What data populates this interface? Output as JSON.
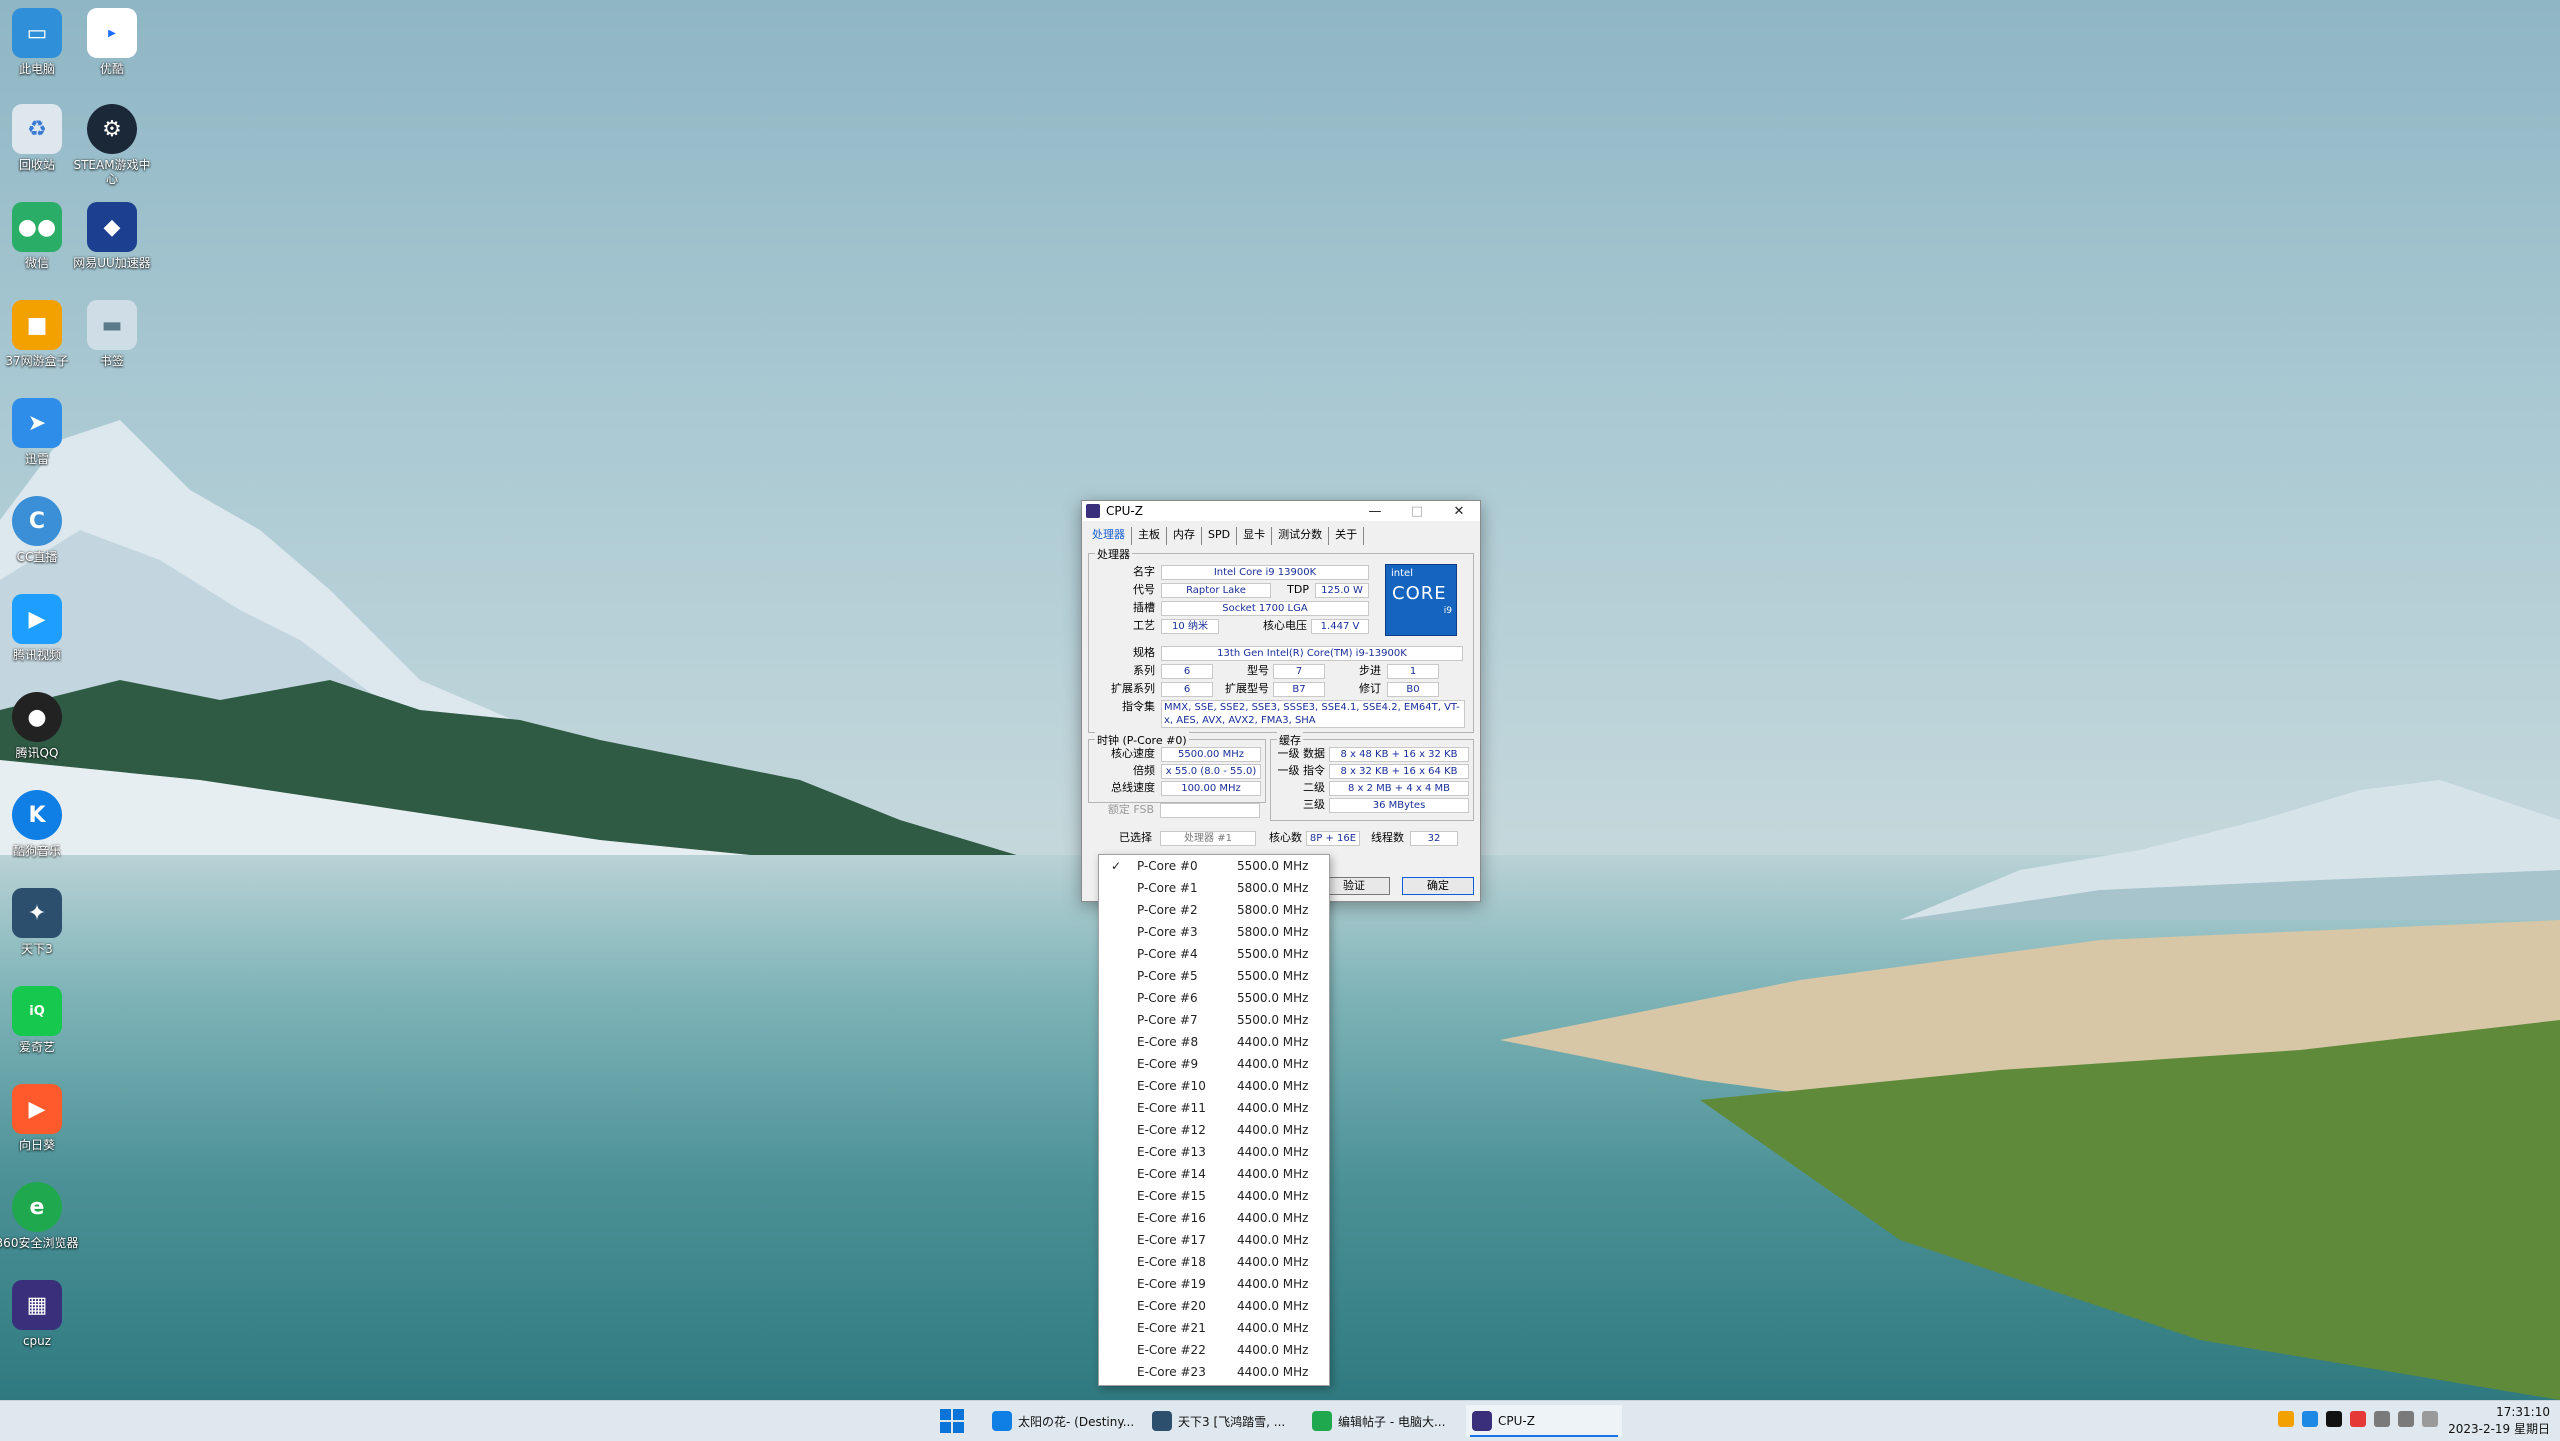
{
  "desktop": {
    "icons": [
      {
        "label": "此电脑",
        "color": "#2f8fd8"
      },
      {
        "label": "优酷",
        "color": "#e8f0ff",
        "glyph": "YOUKU"
      },
      {
        "label": "回收站",
        "color": "#dfe7ee"
      },
      {
        "label": "STEAM游戏中心",
        "color": "#1b2838"
      },
      {
        "label": "微信",
        "color": "#2aae67"
      },
      {
        "label": "网易UU加速器",
        "color": "#1d3f8f"
      },
      {
        "label": "37网游盒子",
        "color": "#f2a100"
      },
      {
        "label": "书签",
        "color": "#cfdde6"
      },
      {
        "label": "迅雷",
        "color": "#2e8de8"
      },
      {
        "label": "CC直播",
        "color": "#3a8fd6"
      },
      {
        "label": "腾讯视频",
        "color": "#1e9fff"
      },
      {
        "label": "腾讯QQ",
        "color": "#222"
      },
      {
        "label": "酷狗音乐",
        "color": "#0f7fe6"
      },
      {
        "label": "天下3",
        "color": "#2c4f6e"
      },
      {
        "label": "爱奇艺",
        "color": "#16c84d"
      },
      {
        "label": "向日葵",
        "color": "#ff5a2c"
      },
      {
        "label": "360安全浏览器",
        "color": "#1fa84e"
      },
      {
        "label": "cpuz",
        "color": "#3a2f7a"
      }
    ]
  },
  "cpuz": {
    "title": "CPU-Z",
    "window_buttons": {
      "minimize": "—",
      "maximize": "□",
      "close": "✕"
    },
    "tabs": [
      "处理器",
      "主板",
      "内存",
      "SPD",
      "显卡",
      "测试分数",
      "关于"
    ],
    "processor_legend": "处理器",
    "labels": {
      "name": "名字",
      "codename": "代号",
      "tdp": "TDP",
      "package": "插槽",
      "technology": "工艺",
      "core_voltage": "核心电压",
      "specification": "规格",
      "family": "系列",
      "model": "型号",
      "stepping": "步进",
      "ext_family": "扩展系列",
      "ext_model": "扩展型号",
      "revision": "修订",
      "instructions": "指令集"
    },
    "values": {
      "name": "Intel Core i9 13900K",
      "codename": "Raptor Lake",
      "tdp": "125.0 W",
      "package": "Socket 1700 LGA",
      "technology": "10 纳米",
      "core_voltage": "1.447 V",
      "specification": "13th Gen Intel(R) Core(TM) i9-13900K",
      "family": "6",
      "model": "7",
      "stepping": "1",
      "ext_family": "6",
      "ext_model": "B7",
      "revision": "B0",
      "instructions": "MMX, SSE, SSE2, SSE3, SSSE3, SSE4.1, SSE4.2, EM64T, VT-x, AES, AVX, AVX2, FMA3, SHA"
    },
    "logo": {
      "brand": "intel",
      "line": "CORE",
      "tier": "i9"
    },
    "clocks": {
      "legend": "时钟 (P-Core #0)",
      "core_speed_label": "核心速度",
      "core_speed": "5500.00 MHz",
      "multiplier_label": "倍频",
      "multiplier": "x 55.0 (8.0 - 55.0)",
      "bus_speed_label": "总线速度",
      "bus_speed": "100.00 MHz",
      "rated_fsb_label": "额定 FSB",
      "rated_fsb": ""
    },
    "cache": {
      "legend": "缓存",
      "l1d_label": "一级 数据",
      "l1d": "8 x 48 KB + 16 x 32 KB",
      "l1i_label": "一级 指令",
      "l1i": "8 x 32 KB + 16 x 64 KB",
      "l2_label": "二级",
      "l2": "8 x 2 MB + 4 x 4 MB",
      "l3_label": "三级",
      "l3": "36 MBytes"
    },
    "bottom": {
      "selection_label": "已选择",
      "selection_value": "处理器 #1",
      "cores_label": "核心数",
      "cores": "8P + 16E",
      "threads_label": "线程数",
      "threads": "32"
    },
    "buttons": {
      "validate": "验证",
      "ok": "确定"
    }
  },
  "dropdown": {
    "items": [
      {
        "name": "P-Core #0",
        "freq": "5500.0 MHz",
        "checked": "✓"
      },
      {
        "name": "P-Core #1",
        "freq": "5800.0 MHz",
        "checked": ""
      },
      {
        "name": "P-Core #2",
        "freq": "5800.0 MHz",
        "checked": ""
      },
      {
        "name": "P-Core #3",
        "freq": "5800.0 MHz",
        "checked": ""
      },
      {
        "name": "P-Core #4",
        "freq": "5500.0 MHz",
        "checked": ""
      },
      {
        "name": "P-Core #5",
        "freq": "5500.0 MHz",
        "checked": ""
      },
      {
        "name": "P-Core #6",
        "freq": "5500.0 MHz",
        "checked": ""
      },
      {
        "name": "P-Core #7",
        "freq": "5500.0 MHz",
        "checked": ""
      },
      {
        "name": "E-Core #8",
        "freq": "4400.0 MHz",
        "checked": ""
      },
      {
        "name": "E-Core #9",
        "freq": "4400.0 MHz",
        "checked": ""
      },
      {
        "name": "E-Core #10",
        "freq": "4400.0 MHz",
        "checked": ""
      },
      {
        "name": "E-Core #11",
        "freq": "4400.0 MHz",
        "checked": ""
      },
      {
        "name": "E-Core #12",
        "freq": "4400.0 MHz",
        "checked": ""
      },
      {
        "name": "E-Core #13",
        "freq": "4400.0 MHz",
        "checked": ""
      },
      {
        "name": "E-Core #14",
        "freq": "4400.0 MHz",
        "checked": ""
      },
      {
        "name": "E-Core #15",
        "freq": "4400.0 MHz",
        "checked": ""
      },
      {
        "name": "E-Core #16",
        "freq": "4400.0 MHz",
        "checked": ""
      },
      {
        "name": "E-Core #17",
        "freq": "4400.0 MHz",
        "checked": ""
      },
      {
        "name": "E-Core #18",
        "freq": "4400.0 MHz",
        "checked": ""
      },
      {
        "name": "E-Core #19",
        "freq": "4400.0 MHz",
        "checked": ""
      },
      {
        "name": "E-Core #20",
        "freq": "4400.0 MHz",
        "checked": ""
      },
      {
        "name": "E-Core #21",
        "freq": "4400.0 MHz",
        "checked": ""
      },
      {
        "name": "E-Core #22",
        "freq": "4400.0 MHz",
        "checked": ""
      },
      {
        "name": "E-Core #23",
        "freq": "4400.0 MHz",
        "checked": ""
      }
    ]
  },
  "taskbar": {
    "items": [
      {
        "label": "太阳の花- (Destiny...",
        "color": "#0f7fe6",
        "active": false
      },
      {
        "label": "天下3 [飞鸿踏雪, ...",
        "color": "#2c4f6e",
        "active": false
      },
      {
        "label": "编辑帖子 - 电脑大...",
        "color": "#1fa84e",
        "active": false
      },
      {
        "label": "CPU-Z",
        "color": "#3a2f7a",
        "active": true
      }
    ],
    "tray_colors": [
      "#f2a100",
      "#1e88e5",
      "#111",
      "#e53935",
      "#555",
      "#555",
      "#555"
    ],
    "time": "17:31:10",
    "date": "2023-2-19 星期日"
  }
}
